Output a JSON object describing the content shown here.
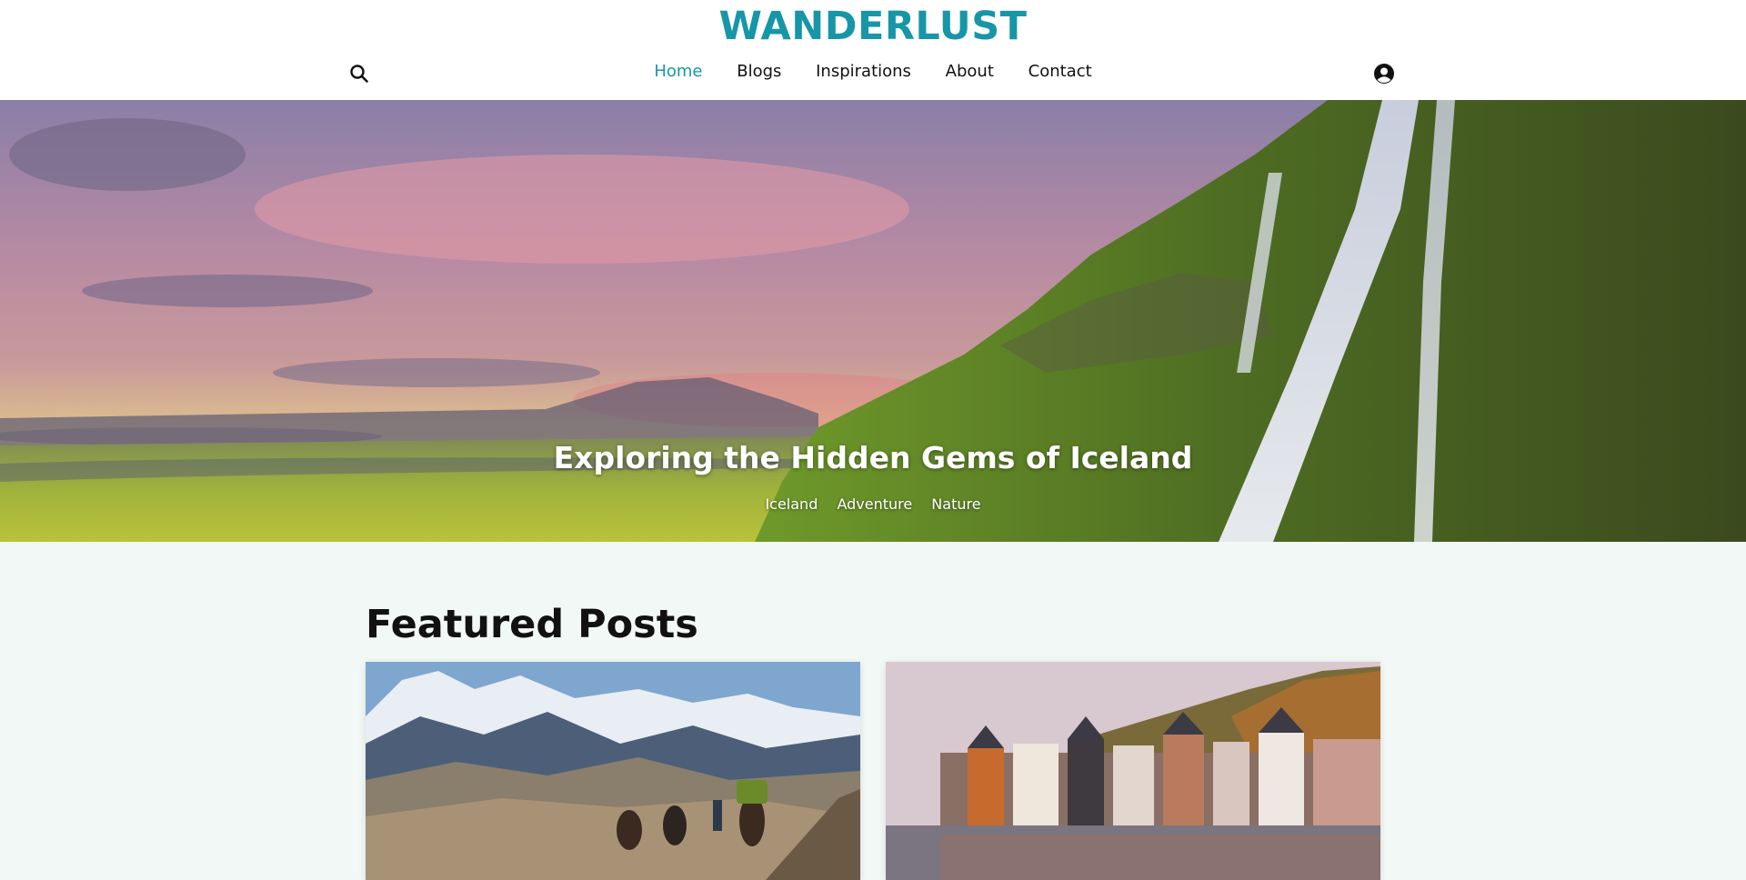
{
  "header": {
    "logo": "WANDERLUST",
    "nav": [
      {
        "label": "Home",
        "active": true
      },
      {
        "label": "Blogs",
        "active": false
      },
      {
        "label": "Inspirations",
        "active": false
      },
      {
        "label": "About",
        "active": false
      },
      {
        "label": "Contact",
        "active": false
      }
    ],
    "icons": {
      "search": "search-icon",
      "account": "user-circle-icon"
    }
  },
  "hero": {
    "title": "Exploring the Hidden Gems of Iceland",
    "tags": [
      "Iceland",
      "Adventure",
      "Nature"
    ]
  },
  "featured": {
    "heading": "Featured Posts"
  },
  "colors": {
    "accent": "#1796a8",
    "page_background": "#f2f8f5",
    "header_background": "#ffffff"
  }
}
